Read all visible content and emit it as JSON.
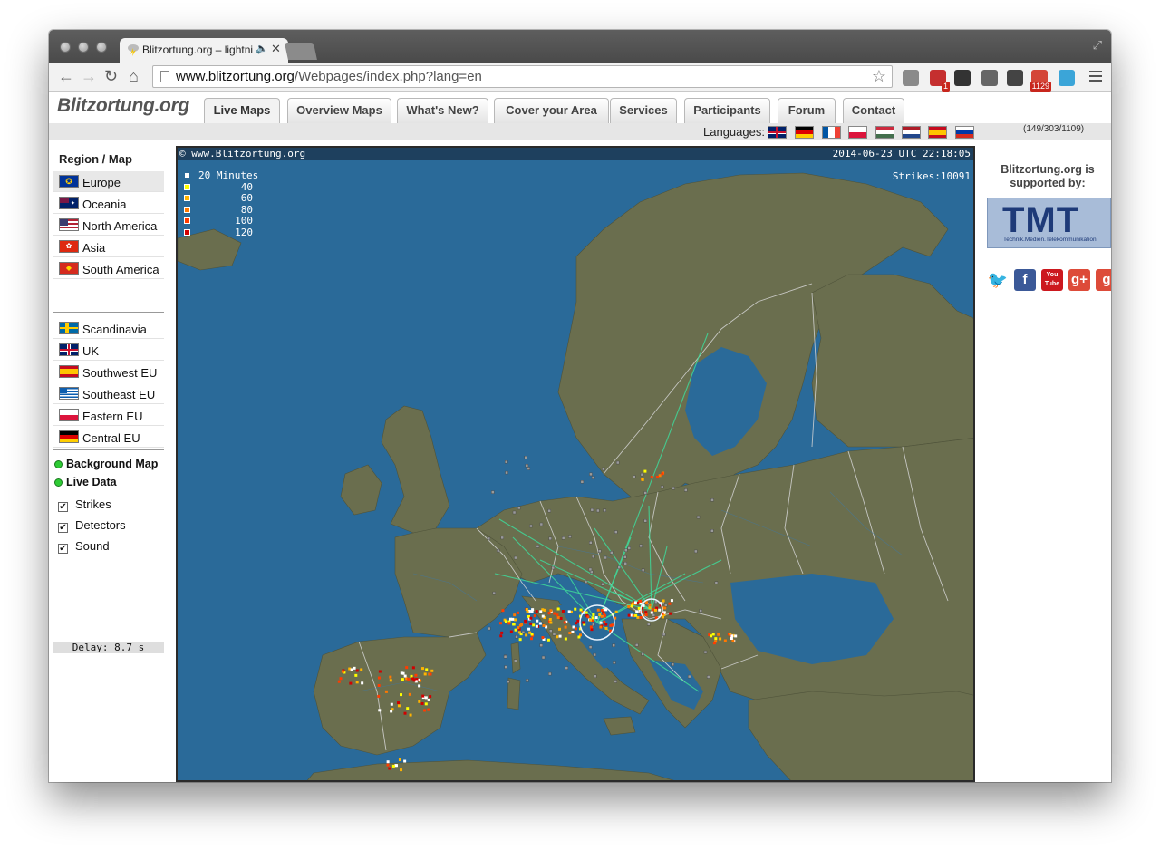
{
  "browser": {
    "tab_title": "Blitzortung.org – lightni",
    "tab_close": "✕",
    "speaker_glyph": "🔈",
    "url_domain": "www.blitzortung.org",
    "url_path": "/Webpages/index.php?lang=en",
    "back_glyph": "←",
    "forward_glyph": "→",
    "reload_glyph": "↻",
    "home_glyph": "⌂",
    "star_glyph": "☆",
    "extensions": [
      {
        "name": "extension-icon-1",
        "badge": "",
        "color": "#8a8a8a"
      },
      {
        "name": "extension-icon-2",
        "badge": "1",
        "color": "#c52f2f"
      },
      {
        "name": "extension-icon-3",
        "badge": "",
        "color": "#333333"
      },
      {
        "name": "cast-icon",
        "badge": "",
        "color": "#666666"
      },
      {
        "name": "incognito-icon",
        "badge": "",
        "color": "#444444"
      },
      {
        "name": "gmail-icon",
        "badge": "1129",
        "color": "#d44638"
      },
      {
        "name": "extension-icon-m",
        "badge": "",
        "color": "#3ba5d8"
      }
    ]
  },
  "site": {
    "logo": "Blitzortung.org",
    "nav": [
      "Live Maps",
      "Overview Maps",
      "What's New?",
      "Cover your Area",
      "Services",
      "Participants",
      "Forum",
      "Contact"
    ],
    "active_nav": "Live Maps",
    "languages_label": "Languages:",
    "languages": [
      "en",
      "de",
      "fr",
      "pl",
      "hu",
      "nl",
      "es",
      "ru"
    ],
    "counts": "(149/303/1109)"
  },
  "sidebar": {
    "title": "Region / Map",
    "regions_group1": [
      {
        "label": "Europe",
        "flag": "eu",
        "selected": true
      },
      {
        "label": "Oceania",
        "flag": "au"
      },
      {
        "label": "North America",
        "flag": "us"
      },
      {
        "label": "Asia",
        "flag": "hk"
      },
      {
        "label": "South America",
        "flag": "sa"
      }
    ],
    "regions_group2": [
      {
        "label": "Scandinavia",
        "flag": "se"
      },
      {
        "label": "UK",
        "flag": "uk"
      },
      {
        "label": "Southwest EU",
        "flag": "es"
      },
      {
        "label": "Southeast EU",
        "flag": "gr"
      },
      {
        "label": "Eastern EU",
        "flag": "pl"
      },
      {
        "label": "Central EU",
        "flag": "de"
      }
    ],
    "background_map": "Background Map",
    "live_data": "Live Data",
    "checks": [
      {
        "label": "Strikes",
        "checked": true
      },
      {
        "label": "Detectors",
        "checked": true
      },
      {
        "label": "Sound",
        "checked": true
      }
    ],
    "delay": "Delay: 8.7 s"
  },
  "map": {
    "watermark": "© www.Blitzortung.org",
    "timestamp": "2014-06-23 UTC 22:18:05",
    "strikes": "Strikes:10091",
    "legend": [
      {
        "label": "20 Minutes",
        "color": "#ffffff"
      },
      {
        "label": "40",
        "color": "#ffff00"
      },
      {
        "label": "60",
        "color": "#ffb400"
      },
      {
        "label": "80",
        "color": "#ff7800"
      },
      {
        "label": "100",
        "color": "#ff3c00"
      },
      {
        "label": "120",
        "color": "#d20000"
      }
    ],
    "colors": {
      "sea": "#2a6a99",
      "land": "#6a6e4e",
      "border": "#d8d8d8",
      "ray": "#3fd99a"
    }
  },
  "right": {
    "support_text": "Blitzortung.org is supported by:",
    "tmt_logo": "TMT",
    "tmt_tagline": "Technik.Medien.Telekommunikation.",
    "social": [
      {
        "name": "twitter-icon",
        "glyph": "🐦",
        "color": "#1da1f2"
      },
      {
        "name": "facebook-icon",
        "glyph": "f",
        "color": "#3b5998"
      },
      {
        "name": "youtube-icon",
        "glyph": "You Tube",
        "color": "#cc181e"
      },
      {
        "name": "google-plus-icon",
        "glyph": "g+",
        "color": "#dd4b39"
      },
      {
        "name": "google-plus-icon-2",
        "glyph": "g",
        "color": "#dd4b39"
      }
    ]
  }
}
